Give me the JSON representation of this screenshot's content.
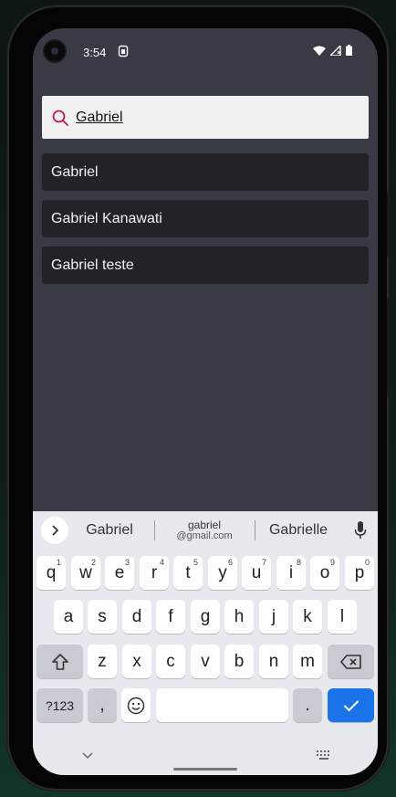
{
  "status_bar": {
    "time": "3:54"
  },
  "search": {
    "value": "Gabriel",
    "icon": "search-icon",
    "accent_color": "#c2185b"
  },
  "results": [
    {
      "label": "Gabriel"
    },
    {
      "label": "Gabriel Kanawati"
    },
    {
      "label": "Gabriel teste"
    }
  ],
  "keyboard": {
    "suggestions": {
      "left": "Gabriel",
      "center_line1": "gabriel",
      "center_line2": "@gmail.com",
      "right": "Gabrielle"
    },
    "row1": [
      {
        "label": "q",
        "hint": "1"
      },
      {
        "label": "w",
        "hint": "2"
      },
      {
        "label": "e",
        "hint": "3"
      },
      {
        "label": "r",
        "hint": "4"
      },
      {
        "label": "t",
        "hint": "5"
      },
      {
        "label": "y",
        "hint": "6"
      },
      {
        "label": "u",
        "hint": "7"
      },
      {
        "label": "i",
        "hint": "8"
      },
      {
        "label": "o",
        "hint": "9"
      },
      {
        "label": "p",
        "hint": "0"
      }
    ],
    "row2": [
      "a",
      "s",
      "d",
      "f",
      "g",
      "h",
      "j",
      "k",
      "l"
    ],
    "row3": [
      "z",
      "x",
      "c",
      "v",
      "b",
      "n",
      "m"
    ],
    "symbols_label": "?123",
    "comma_label": ",",
    "period_label": ".",
    "accent_color": "#1a73e8"
  }
}
